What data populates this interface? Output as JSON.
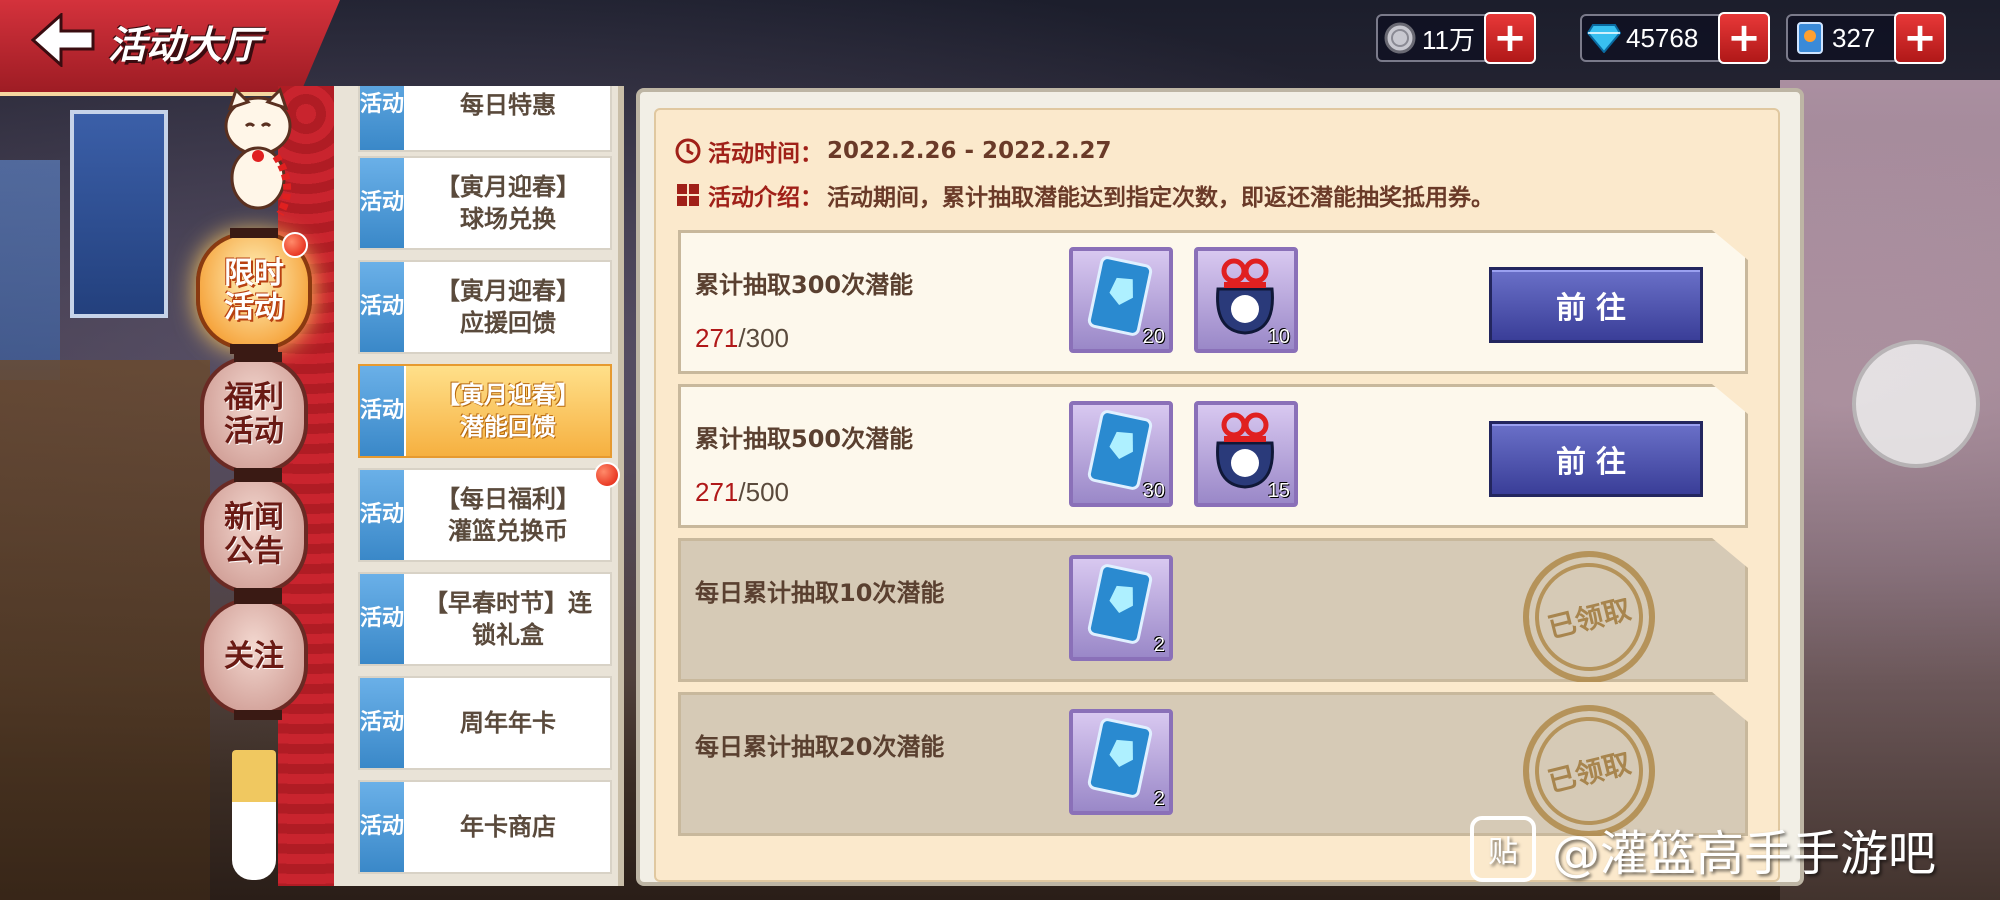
{
  "header": {
    "title": "活动大厅",
    "currencies": [
      {
        "icon": "silver-coin-icon",
        "value": "11万"
      },
      {
        "icon": "diamond-icon",
        "value": "45768"
      },
      {
        "icon": "ticket-card-icon",
        "value": "327"
      }
    ],
    "plus_label": "+"
  },
  "categories": [
    {
      "label_top": "限时",
      "label_bottom": "活动",
      "active": true,
      "badge": true
    },
    {
      "label_top": "福利",
      "label_bottom": "活动",
      "active": false,
      "badge": false
    },
    {
      "label_top": "新闻",
      "label_bottom": "公告",
      "active": false,
      "badge": false
    },
    {
      "label_top": "关注",
      "label_bottom": "",
      "active": false,
      "badge": false
    }
  ],
  "activities": {
    "tag": "活动",
    "items": [
      {
        "line1": "每日特惠",
        "line2": ""
      },
      {
        "line1": "【寅月迎春】",
        "line2": "球场兑换"
      },
      {
        "line1": "【寅月迎春】",
        "line2": "应援回馈"
      },
      {
        "line1": "【寅月迎春】",
        "line2": "潜能回馈",
        "selected": true
      },
      {
        "line1": "【每日福利】",
        "line2": "灌篮兑换币",
        "badge": true
      },
      {
        "line1": "【早春时节】连",
        "line2": "锁礼盒"
      },
      {
        "line1": "周年年卡",
        "line2": ""
      },
      {
        "line1": "年卡商店",
        "line2": ""
      }
    ]
  },
  "detail": {
    "time_label": "活动时间：",
    "time_value": "2022.2.26 - 2022.2.27",
    "intro_label": "活动介绍：",
    "intro_value": "活动期间，累计抽取潜能达到指定次数，即返还潜能抽奖抵用券。",
    "tasks": [
      {
        "title": "累计抽取300次潜能",
        "current": "271",
        "total": "/300",
        "rewards": [
          {
            "type": "ticket",
            "qty": "20"
          },
          {
            "type": "lucky-bag",
            "qty": "10"
          }
        ],
        "button": "前往",
        "claimed": false
      },
      {
        "title": "累计抽取500次潜能",
        "current": "271",
        "total": "/500",
        "rewards": [
          {
            "type": "ticket",
            "qty": "30"
          },
          {
            "type": "lucky-bag",
            "qty": "15"
          }
        ],
        "button": "前往",
        "claimed": false
      },
      {
        "title": "每日累计抽取10次潜能",
        "rewards": [
          {
            "type": "ticket",
            "qty": "2"
          }
        ],
        "stamp": "已领取",
        "claimed": true
      },
      {
        "title": "每日累计抽取20次潜能",
        "rewards": [
          {
            "type": "ticket",
            "qty": "2"
          }
        ],
        "stamp": "已领取",
        "claimed": true
      }
    ]
  },
  "watermark": {
    "logo": "贴",
    "text": "@灌篮高手手游吧"
  },
  "colors": {
    "accent_red": "#b01818",
    "button_blue": "#3a3e98",
    "active_orange": "#f6a640"
  }
}
